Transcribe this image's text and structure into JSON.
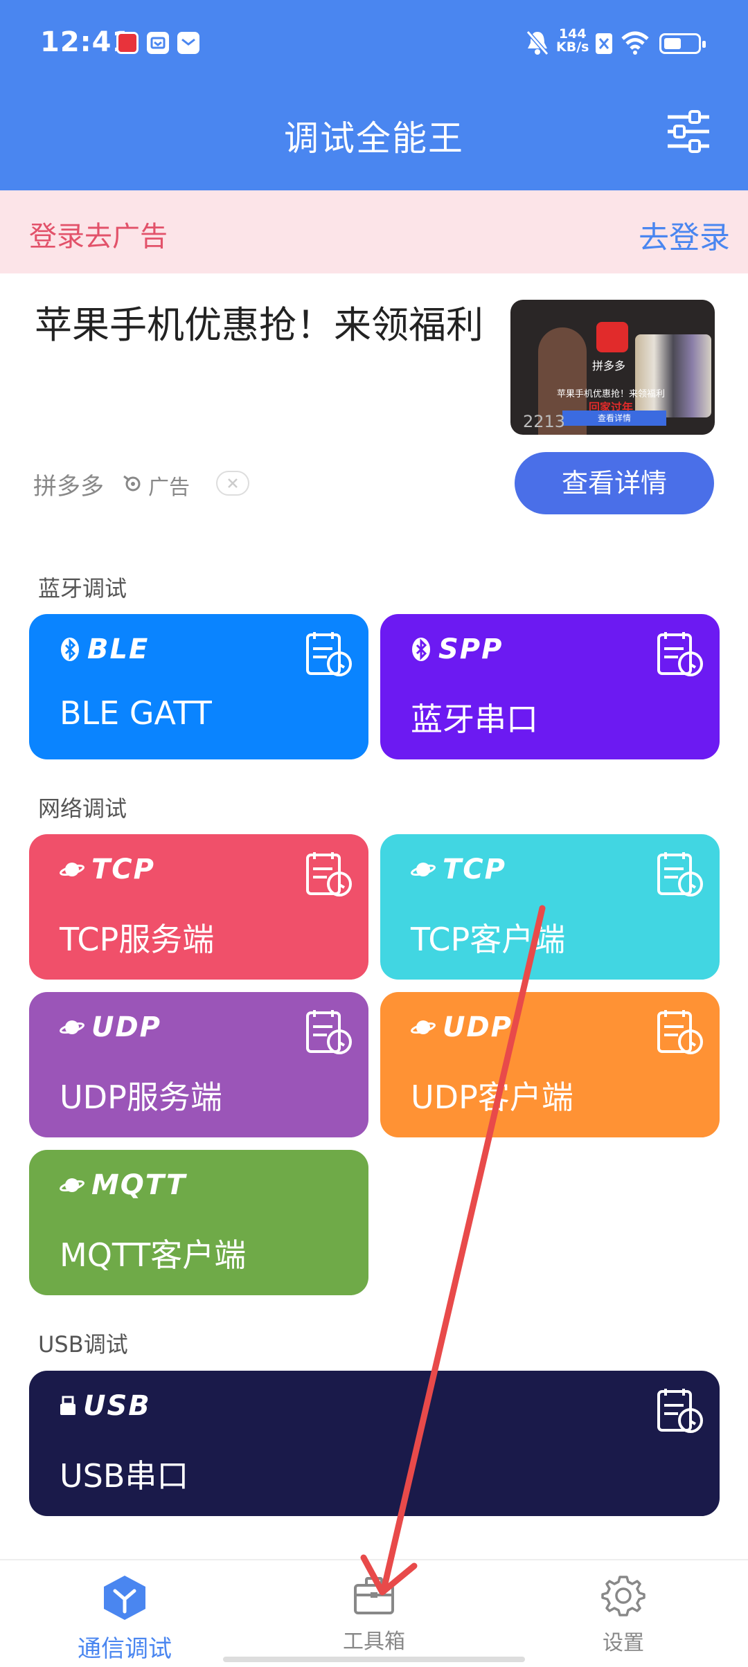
{
  "status_bar": {
    "time": "12:41",
    "speed_value": "144",
    "speed_unit": "KB/s"
  },
  "app_bar": {
    "title": "调试全能王",
    "filter_icon": "sliders-icon"
  },
  "login_banner": {
    "text": "登录去广告",
    "link": "去登录"
  },
  "ad": {
    "title": "苹果手机优惠抢！来领福利",
    "source": "拼多多",
    "tag": "广告",
    "button": "查看详情",
    "thumb_brand": "拼多多",
    "thumb_caption": "苹果手机优惠抢！来领福利",
    "thumb_caption2": "回家过年",
    "thumb_button": "查看详情",
    "thumb_counter": "2213"
  },
  "sections": {
    "bluetooth": "蓝牙调试",
    "network": "网络调试",
    "usb": "USB调试"
  },
  "cards": {
    "ble": {
      "proto": "BLE",
      "name": "BLE GATT",
      "color": "#0A84FF"
    },
    "spp": {
      "proto": "SPP",
      "name": "蓝牙串口",
      "color": "#6C1AF2"
    },
    "tcp_server": {
      "proto": "TCP",
      "name": "TCP服务端",
      "color": "#F0506A"
    },
    "tcp_client": {
      "proto": "TCP",
      "name": "TCP客户端",
      "color": "#41D6E2"
    },
    "udp_server": {
      "proto": "UDP",
      "name": "UDP服务端",
      "color": "#9B55B8"
    },
    "udp_client": {
      "proto": "UDP",
      "name": "UDP客户端",
      "color": "#FF9234"
    },
    "mqtt_client": {
      "proto": "MQTT",
      "name": "MQTT客户端",
      "color": "#6FAA48"
    },
    "usb_serial": {
      "proto": "USB",
      "name": "USB串口",
      "color": "#1A1A4A"
    }
  },
  "bottom_nav": {
    "comm": "通信调试",
    "tools": "工具箱",
    "settings": "设置",
    "active": "comm"
  },
  "colors": {
    "primary": "#4A86F0",
    "annotation_arrow": "#E84A4A"
  }
}
